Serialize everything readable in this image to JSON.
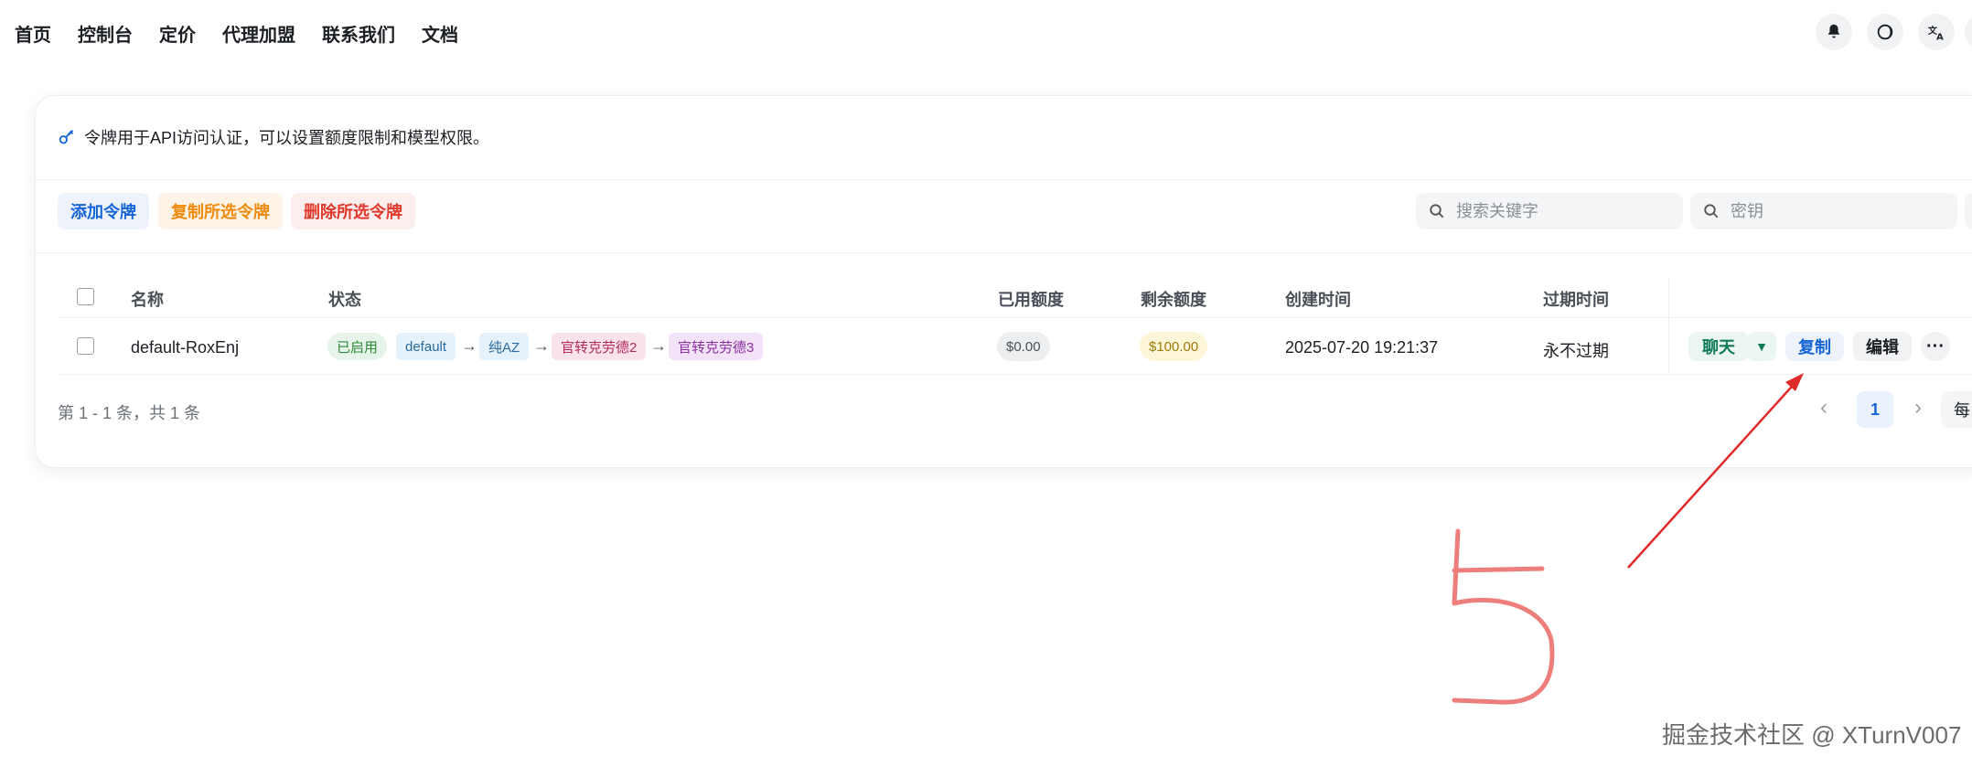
{
  "nav": {
    "links": [
      "首页",
      "控制台",
      "定价",
      "代理加盟",
      "联系我们",
      "文档"
    ],
    "icons": [
      "bell-icon",
      "moon-icon",
      "translate-icon"
    ]
  },
  "notice": {
    "icon": "key-icon",
    "text": "令牌用于API访问认证，可以设置额度限制和模型权限。"
  },
  "toolbar": {
    "add_label": "添加令牌",
    "copy_label": "复制所选令牌",
    "delete_label": "删除所选令牌",
    "search_keyword_placeholder": "搜索关键字",
    "search_key_placeholder": "密钥"
  },
  "table": {
    "headers": {
      "name": "名称",
      "status": "状态",
      "used": "已用额度",
      "remaining": "剩余额度",
      "created": "创建时间",
      "expires": "过期时间"
    },
    "rows": [
      {
        "name": "default-RoxEnj",
        "status": "已启用",
        "group": "default",
        "chain": [
          "纯AZ",
          "官转克劳德2",
          "官转克劳德3"
        ],
        "used": "$0.00",
        "remaining": "$100.00",
        "created": "2025-07-20 19:21:37",
        "expires": "永不过期",
        "actions": {
          "chat": "聊天",
          "copy": "复制",
          "edit": "编辑",
          "more": "···"
        }
      }
    ]
  },
  "pagination": {
    "summary": "第 1 - 1 条，共 1 条",
    "current": "1",
    "page_size_partial": "每"
  },
  "annotation": {
    "number": "5",
    "color": "#e8534f"
  },
  "watermark": "掘金技术社区 @ XTurnV007",
  "colors": {
    "primary": "#1464d8",
    "warning": "#ee8a0c",
    "danger": "#e0382b",
    "success": "#2f8a3c",
    "chat": "#0e7a5a"
  }
}
